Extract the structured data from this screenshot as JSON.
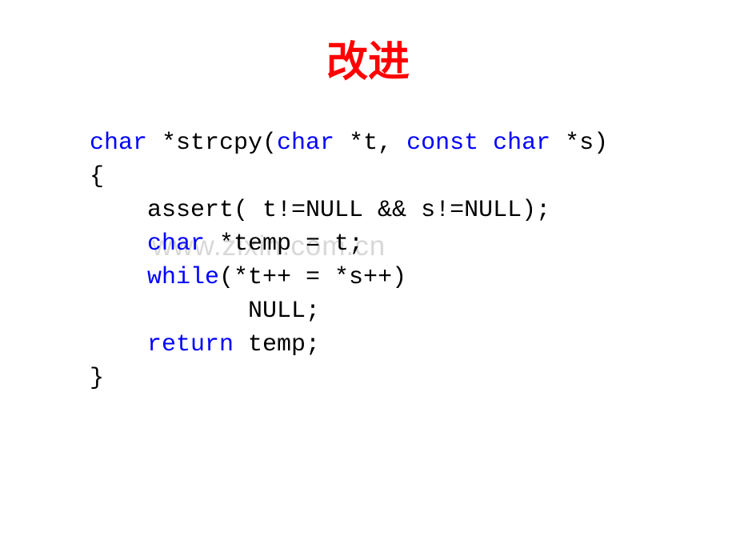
{
  "title": "改进",
  "watermark": "www.zixin.com.cn",
  "code": {
    "line1_kw1": "char",
    "line1_text1": " *strcpy(",
    "line1_kw2": "char",
    "line1_text2": " *t, ",
    "line1_kw3": "const",
    "line1_text3": " ",
    "line1_kw4": "char",
    "line1_text4": " *s)",
    "line2": "{",
    "line3": "    assert( t!=NULL && s!=NULL);",
    "line4_pre": "    ",
    "line4_kw": "char",
    "line4_post": " *temp = t;",
    "line5_pre": "    ",
    "line5_kw": "while",
    "line5_post": "(*t++ = *s++)",
    "line6": "           NULL;",
    "line7_pre": "    ",
    "line7_kw": "return",
    "line7_post": " temp;",
    "line8": "}"
  }
}
